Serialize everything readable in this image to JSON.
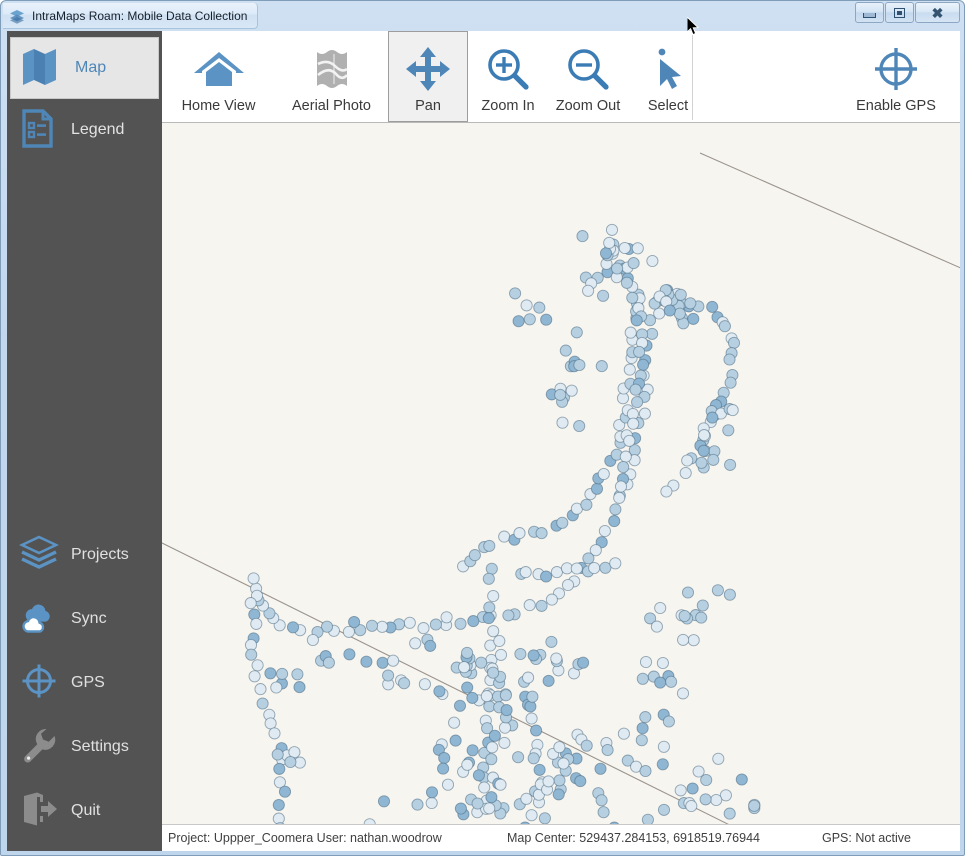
{
  "window": {
    "title": "IntraMaps Roam: Mobile Data Collection",
    "app_icon": "layers-icon",
    "buttons": {
      "minimize": "minimize-button",
      "maximize": "maximize-button",
      "close": "close-button"
    }
  },
  "sidebar": {
    "top_items": [
      {
        "label": "Map",
        "icon": "map-icon",
        "selected": true
      },
      {
        "label": "Legend",
        "icon": "legend-icon",
        "selected": false
      }
    ],
    "bottom_items": [
      {
        "label": "Projects",
        "icon": "layers-icon",
        "selected": false
      },
      {
        "label": "Sync",
        "icon": "cloud-sync-icon",
        "selected": false
      },
      {
        "label": "GPS",
        "icon": "crosshair-icon",
        "selected": false
      },
      {
        "label": "Settings",
        "icon": "wrench-icon",
        "selected": false
      },
      {
        "label": "Quit",
        "icon": "exit-door-icon",
        "selected": false
      }
    ]
  },
  "toolbar": {
    "items": [
      {
        "label": "Home View",
        "icon": "home-icon",
        "active": false
      },
      {
        "label": "Aerial Photo",
        "icon": "aerial-photo-icon",
        "active": false
      },
      {
        "label": "Pan",
        "icon": "pan-arrows-icon",
        "active": true
      },
      {
        "label": "Zoom In",
        "icon": "zoom-in-icon",
        "active": false
      },
      {
        "label": "Zoom Out",
        "icon": "zoom-out-icon",
        "active": false
      },
      {
        "label": "Select",
        "icon": "cursor-select-icon",
        "active": false
      }
    ],
    "right": {
      "label": "Enable GPS",
      "icon": "crosshair-icon",
      "active": false
    }
  },
  "status": {
    "project_label": "Project: Uppper_Coomera  User: nathan.woodrow",
    "map_center": "Map Center: 529437.284153, 6918519.76944",
    "gps": "GPS: Not active"
  },
  "map": {
    "background_color": "#f7f5f0",
    "point_fill_light": "#dfeaf2",
    "point_fill_mid": "#b6d0e2",
    "point_fill_dark": "#8fb6d2",
    "point_stroke": "#4a6a80",
    "line_color": "#9a948c"
  },
  "colors": {
    "accent": "#4f86b8",
    "sidebar_bg": "#535353",
    "icon_gray": "#9e9e9e",
    "title_bar": "#cfe0f2"
  }
}
